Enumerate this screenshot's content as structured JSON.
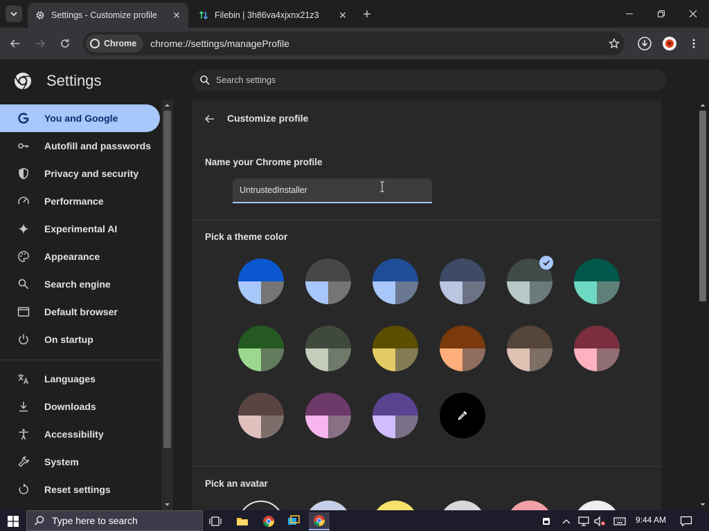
{
  "tabs": [
    {
      "title": "Settings - Customize profile",
      "active": true
    },
    {
      "title": "Filebin | 3h86va4xjxnx21z3",
      "active": false
    }
  ],
  "toolbar": {
    "chip_label": "Chrome",
    "url": "chrome://settings/manageProfile"
  },
  "settings": {
    "title": "Settings",
    "search_placeholder": "Search settings"
  },
  "sidebar": {
    "items": [
      {
        "label": "You and Google",
        "icon": "google-g-icon",
        "active": true
      },
      {
        "label": "Autofill and passwords",
        "icon": "key-icon"
      },
      {
        "label": "Privacy and security",
        "icon": "shield-icon"
      },
      {
        "label": "Performance",
        "icon": "speedometer-icon"
      },
      {
        "label": "Experimental AI",
        "icon": "sparkle-icon"
      },
      {
        "label": "Appearance",
        "icon": "palette-icon"
      },
      {
        "label": "Search engine",
        "icon": "search-icon"
      },
      {
        "label": "Default browser",
        "icon": "browser-window-icon"
      },
      {
        "label": "On startup",
        "icon": "power-icon"
      },
      {
        "label": "Languages",
        "icon": "translate-icon"
      },
      {
        "label": "Downloads",
        "icon": "download-icon"
      },
      {
        "label": "Accessibility",
        "icon": "accessibility-icon"
      },
      {
        "label": "System",
        "icon": "wrench-icon"
      },
      {
        "label": "Reset settings",
        "icon": "reset-icon"
      }
    ]
  },
  "main": {
    "page_title": "Customize profile",
    "name_section_title": "Name your Chrome profile",
    "profile_name": "UntrustedInstaller",
    "theme_section_title": "Pick a theme color",
    "avatar_section_title": "Pick an avatar",
    "theme_colors": [
      {
        "top": "#0b57d0",
        "bl": "#a8c7fa",
        "br": "#757575",
        "selected": false
      },
      {
        "top": "#474747",
        "bl": "#a8c7fa",
        "br": "#757575",
        "selected": false
      },
      {
        "top": "#1f4e99",
        "bl": "#a8c7fa",
        "br": "#6a7892",
        "selected": false
      },
      {
        "top": "#3e4b66",
        "bl": "#bac6e0",
        "br": "#6d7385",
        "selected": false
      },
      {
        "top": "#3f4a49",
        "bl": "#b8c9c7",
        "br": "#6c7a79",
        "selected": true
      },
      {
        "top": "#00574b",
        "bl": "#6ed9c3",
        "br": "#5f7f79",
        "selected": false
      },
      {
        "top": "#245a22",
        "bl": "#9dd88f",
        "br": "#637b5e",
        "selected": false
      },
      {
        "top": "#404a3c",
        "bl": "#c4cdb9",
        "br": "#6f7a6a",
        "selected": false
      },
      {
        "top": "#5c4e00",
        "bl": "#e3cb63",
        "br": "#827b56",
        "selected": false
      },
      {
        "top": "#7a3a0b",
        "bl": "#ffae7c",
        "br": "#8f6d5e",
        "selected": false
      },
      {
        "top": "#54443a",
        "bl": "#ddc1b3",
        "br": "#7d6e66",
        "selected": false
      },
      {
        "top": "#7a2e3e",
        "bl": "#ffb1c0",
        "br": "#8f6e74",
        "selected": false
      },
      {
        "top": "#5a4442",
        "bl": "#e0c0bd",
        "br": "#7d6e6c",
        "selected": false
      },
      {
        "top": "#6e3a69",
        "bl": "#f6b5ee",
        "br": "#897085",
        "selected": false
      },
      {
        "top": "#5a4390",
        "bl": "#d1bcff",
        "br": "#7a7088",
        "selected": false
      }
    ],
    "avatar_colors": [
      "#f0f0f0",
      "#c5cfe8",
      "#f7e06b",
      "#d8d8d8",
      "#f0a0a6",
      "#eeeeee"
    ]
  },
  "taskbar": {
    "search_placeholder": "Type here to search",
    "time": "9:44 AM"
  }
}
